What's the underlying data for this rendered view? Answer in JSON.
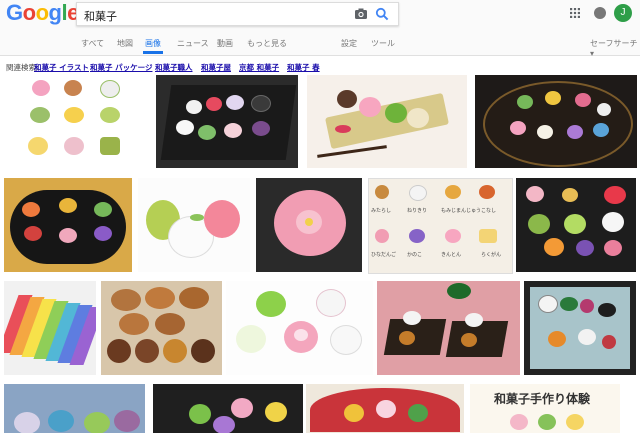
{
  "header": {
    "logo_letters": [
      {
        "char": "G",
        "color": "#4285F4"
      },
      {
        "char": "o",
        "color": "#EA4335"
      },
      {
        "char": "o",
        "color": "#FBBC05"
      },
      {
        "char": "g",
        "color": "#4285F4"
      },
      {
        "char": "l",
        "color": "#34A853"
      },
      {
        "char": "e",
        "color": "#EA4335"
      }
    ],
    "search_query": "和菓子",
    "camera_icon": "camera-icon",
    "search_icon": "search-icon",
    "apps_icon": "apps-grid-icon",
    "notifications_icon": "bell-icon",
    "avatar_letter": "J",
    "avatar_color": "#2e9e48"
  },
  "tabs": {
    "all": "すべて",
    "maps": "地図",
    "images": "画像",
    "news": "ニュース",
    "videos": "動画",
    "more": "もっと見る",
    "settings": "設定",
    "tools": "ツール",
    "safe_search": "セーフサーチ ▾",
    "active": "images",
    "active_color": "#1a73e8"
  },
  "related": {
    "label": "関連検索:",
    "items": [
      "和菓子 イラスト",
      "和菓子 パッケージ",
      "和菓子職人",
      "和菓子屋",
      "京都 和菓子",
      "和菓子 春"
    ]
  },
  "results": {
    "banner_text": "和菓子手作り体験",
    "inner_labels": [
      "みたらし",
      "ねりきり",
      "もみじまんじゅう",
      "こなし",
      "ひなだんご",
      "かのこ",
      "きんとん",
      "らくがん"
    ]
  }
}
